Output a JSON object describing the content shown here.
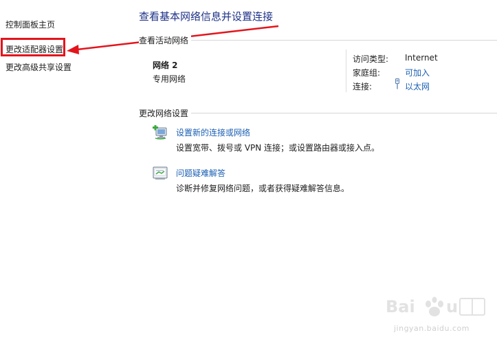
{
  "nav": {
    "home": "控制面板主页",
    "adapter_settings": "更改适配器设置",
    "sharing_settings": "更改高级共享设置"
  },
  "main": {
    "title": "查看基本网络信息并设置连接",
    "active_networks_label": "查看活动网络",
    "network_name": "网络  2",
    "network_type": "专用网络",
    "access_type_label": "访问类型:",
    "access_type_value": "Internet",
    "homegroup_label": "家庭组:",
    "homegroup_value": "可加入",
    "connection_label": "连接:",
    "connection_value": "以太网",
    "change_settings_label": "更改网络设置",
    "tasks": [
      {
        "title": "设置新的连接或网络",
        "desc": "设置宽带、拨号或 VPN 连接；或设置路由器或接入点。"
      },
      {
        "title": "问题疑难解答",
        "desc": "诊断并修复网络问题，或者获得疑难解答信息。"
      }
    ]
  },
  "watermark": {
    "url": "jingyan.baidu.com"
  },
  "colors": {
    "title": "#1e3287",
    "link": "#1a5fb4",
    "annotation": "#e3141c"
  }
}
